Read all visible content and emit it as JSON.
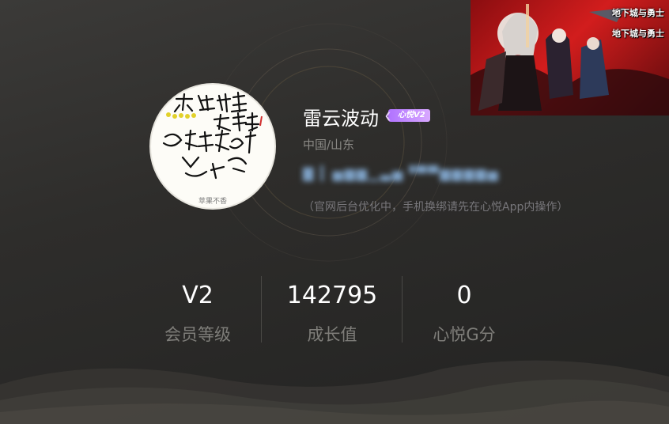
{
  "banner": {
    "logo_top": "地下城与勇士",
    "logo_bottom": "地下城与勇士"
  },
  "avatar": {
    "caption": "苹果不香"
  },
  "profile": {
    "nickname": "雷云波动",
    "vip_badge": "心悦V2",
    "location": "中国/山东",
    "phone_masked": "▇ ▎▅▆▆▁▃▅▝▀▀▆▆▆▆▅",
    "notice": "（官网后台优化中，手机换绑请先在心悦App内操作）"
  },
  "stats": [
    {
      "value": "V2",
      "label": "会员等级"
    },
    {
      "value": "142795",
      "label": "成长值"
    },
    {
      "value": "0",
      "label": "心悦G分"
    }
  ],
  "colors": {
    "badge": "#b072ff",
    "accent_text": "#7ea2c7",
    "muted_text": "#7e7d79"
  }
}
